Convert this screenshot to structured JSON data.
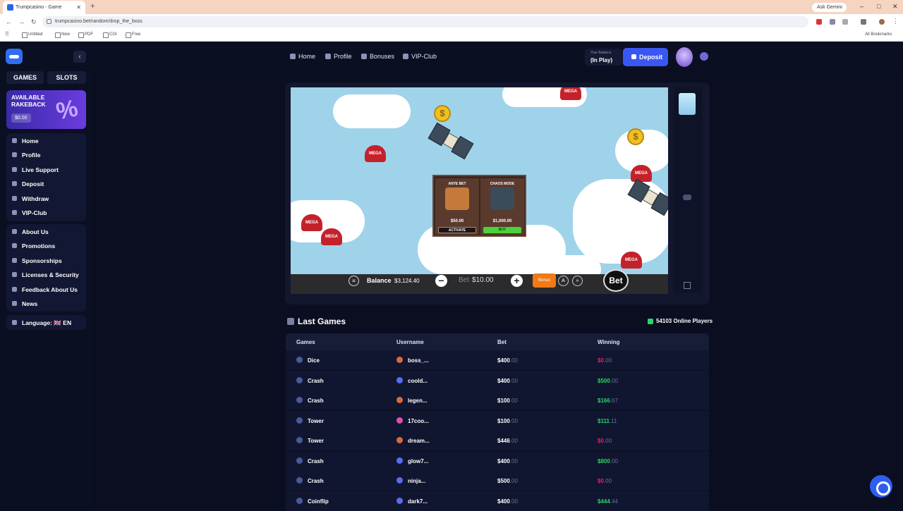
{
  "browser": {
    "tab_title": "Trumpcasino - Game",
    "url": "trumpcasino.bet/random/drop_the_boss",
    "gemini": "Ask Gemini",
    "bookmarks": [
      "Untitled",
      "New",
      "PDF",
      "CGI",
      "Free"
    ],
    "all_bookmarks": "All Bookmarks"
  },
  "sidebar": {
    "tabs": [
      "GAMES",
      "SLOTS"
    ],
    "rakeback": {
      "title": "AVAILABLE RAKEBACK",
      "amount": "$0.00",
      "icon": "%"
    },
    "group1": [
      "Home",
      "Profile",
      "Live Support",
      "Deposit",
      "Withdraw",
      "VIP-Club"
    ],
    "group2": [
      "About Us",
      "Promotions",
      "Sponsorships",
      "Licenses & Security",
      "Feedback About Us",
      "News"
    ],
    "language": "Language: 🇬🇧 EN"
  },
  "topnav": {
    "items": [
      "Home",
      "Profile",
      "Bonuses",
      "VIP-Club"
    ],
    "balance_label": "Your Balance",
    "balance_value": "(In Play)",
    "deposit": "Deposit"
  },
  "game": {
    "popup": {
      "left": {
        "title": "ANTE BET",
        "price": "$50.00",
        "button": "ACTIVATE"
      },
      "right": {
        "title": "CHAOS MODE",
        "price": "$1,000.00",
        "button": "BUY"
      }
    },
    "hat_label": "MEGA",
    "coin_symbol": "$",
    "balance_label": "Balance",
    "balance_value": "$3,124.40",
    "bet_label": "Bet",
    "bet_value": "$10.00",
    "bonus": "Bonus",
    "bet_button": "Bet"
  },
  "last_games": {
    "title": "Last Games",
    "online": "54103 Online Players",
    "headers": [
      "Games",
      "Username",
      "Bet",
      "Winning"
    ],
    "rows": [
      {
        "game": "Dice",
        "user": "boss_...",
        "bet": "$400",
        "bet_c": ".00",
        "win": "$0",
        "win_c": ".00",
        "status": "loss",
        "avatar": "#d96b39"
      },
      {
        "game": "Crash",
        "user": "coold...",
        "bet": "$400",
        "bet_c": ".00",
        "win": "$500",
        "win_c": ".00",
        "status": "win",
        "avatar": "#5a6cf0"
      },
      {
        "game": "Crash",
        "user": "legen...",
        "bet": "$100",
        "bet_c": ".00",
        "win": "$166",
        "win_c": ".67",
        "status": "win",
        "avatar": "#d96b39"
      },
      {
        "game": "Tower",
        "user": "17coo...",
        "bet": "$100",
        "bet_c": ".00",
        "win": "$111",
        "win_c": ".11",
        "status": "win",
        "avatar": "#e04fb0"
      },
      {
        "game": "Tower",
        "user": "dream...",
        "bet": "$446",
        "bet_c": ".00",
        "win": "$0",
        "win_c": ".00",
        "status": "loss",
        "avatar": "#d96b39"
      },
      {
        "game": "Crash",
        "user": "glow7...",
        "bet": "$400",
        "bet_c": ".00",
        "win": "$800",
        "win_c": ".00",
        "status": "win",
        "avatar": "#5a6cf0"
      },
      {
        "game": "Crash",
        "user": "ninja...",
        "bet": "$500",
        "bet_c": ".00",
        "win": "$0",
        "win_c": ".00",
        "status": "loss",
        "avatar": "#5a6cf0"
      },
      {
        "game": "Coinflip",
        "user": "dark7...",
        "bet": "$400",
        "bet_c": ".00",
        "win": "$444",
        "win_c": ".44",
        "status": "win",
        "avatar": "#5a6cf0"
      }
    ]
  },
  "colors": {
    "accent": "#3b57f2",
    "win": "#2bd36a",
    "loss": "#e0245e",
    "bonus": "#f07a17"
  }
}
